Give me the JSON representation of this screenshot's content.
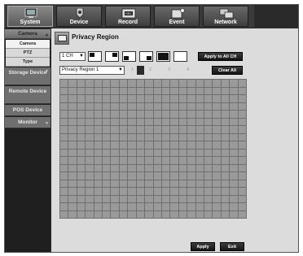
{
  "nav": {
    "items": [
      {
        "label": "System",
        "icon": "system-icon",
        "active": true
      },
      {
        "label": "Device",
        "icon": "device-icon",
        "active": false
      },
      {
        "label": "Record",
        "icon": "record-icon",
        "active": false
      },
      {
        "label": "Event",
        "icon": "event-icon",
        "active": false
      },
      {
        "label": "Network",
        "icon": "network-icon",
        "active": false
      }
    ]
  },
  "sidebar": {
    "camera": "Camera",
    "sub_camera": "Camera",
    "sub_ptz": "PTZ",
    "sub_type": "Type",
    "storage": "Storage Device",
    "remote": "Remote Device",
    "pos": "POS Device",
    "monitor": "Monitor"
  },
  "main": {
    "title": "Privacy Region",
    "channel_value": "1 CH",
    "apply_all_label": "Apply to All CH",
    "region_value": "Privacy Region 1",
    "region_numbers": [
      "1",
      "2",
      "3",
      "4"
    ],
    "active_number": "1",
    "clear_all_label": "Clear All",
    "apply_label": "Apply",
    "exit_label": "Exit"
  },
  "colors": {
    "grid_cell": "#9a9a9a",
    "panel_bg": "#dcdcdc",
    "frame_bg": "#2a2a2a"
  }
}
